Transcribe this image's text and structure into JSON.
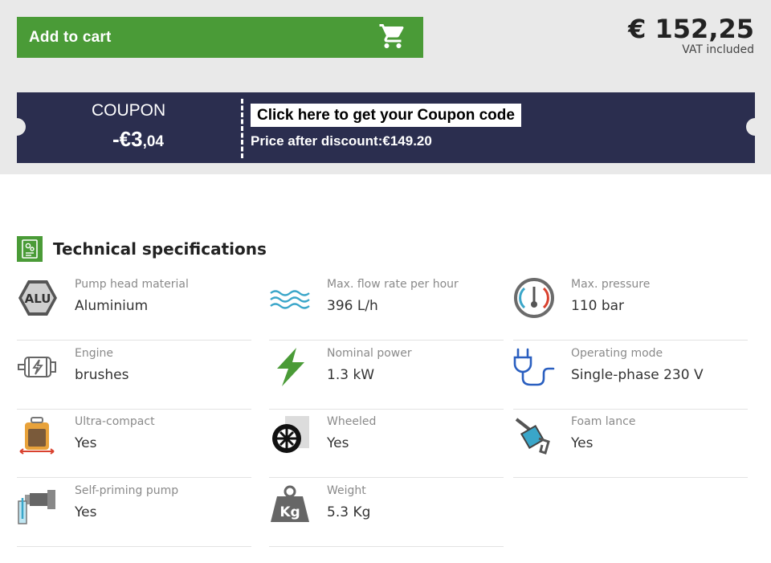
{
  "cart": {
    "add_label": "Add to cart",
    "icon": "shopping-cart-icon"
  },
  "price": {
    "amount": "€ 152,25",
    "vat_note": "VAT included"
  },
  "coupon": {
    "title": "COUPON",
    "discount_main": "-€3",
    "discount_cents": ",04",
    "cta": "Click here to get your Coupon code",
    "price_after": "Price after discount:€149.20"
  },
  "colors": {
    "accent_green": "#4a9b37",
    "coupon_bg": "#2b2e4f",
    "band_bg": "#e9e9e9"
  },
  "specs": {
    "title": "Technical specifications",
    "icon": "spec-sheet-icon",
    "items": [
      {
        "label": "Pump head material",
        "value": "Aluminium",
        "icon": "alu-hexagon-icon"
      },
      {
        "label": "Max. flow rate per hour",
        "value": "396 L/h",
        "icon": "water-waves-icon"
      },
      {
        "label": "Max. pressure",
        "value": "110 bar",
        "icon": "pressure-gauge-icon"
      },
      {
        "label": "Engine",
        "value": "brushes",
        "icon": "motor-icon"
      },
      {
        "label": "Nominal power",
        "value": "1.3 kW",
        "icon": "lightning-icon"
      },
      {
        "label": "Operating mode",
        "value": "Single-phase 230 V",
        "icon": "power-plug-icon"
      },
      {
        "label": "Ultra-compact",
        "value": "Yes",
        "icon": "compact-unit-icon"
      },
      {
        "label": "Wheeled",
        "value": "Yes",
        "icon": "wheel-icon"
      },
      {
        "label": "Foam lance",
        "value": "Yes",
        "icon": "foam-lance-icon"
      },
      {
        "label": "Self-priming pump",
        "value": "Yes",
        "icon": "self-priming-pump-icon"
      },
      {
        "label": "Weight",
        "value": "5.3 Kg",
        "icon": "weight-kg-icon"
      }
    ]
  }
}
